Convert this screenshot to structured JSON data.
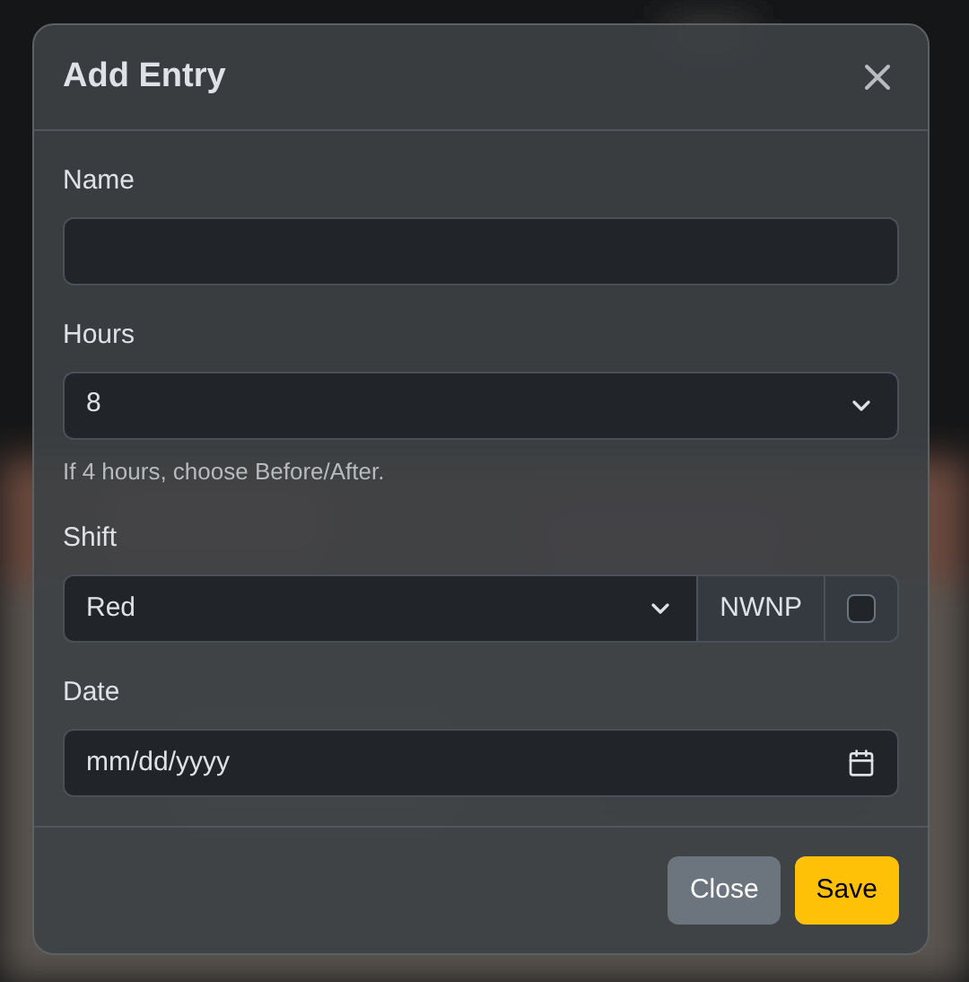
{
  "dialog": {
    "title": "Add Entry"
  },
  "fields": [
    {
      "kind": "text",
      "label": "Name"
    },
    {
      "kind": "select",
      "label": "Hours",
      "value": "8",
      "help": "If 4 hours, choose Before/After."
    },
    {
      "kind": "select-addon",
      "label": "Shift",
      "value": "Red",
      "addon": "NWNP",
      "checked": false
    },
    {
      "kind": "date",
      "label": "Date",
      "placeholder": "mm/dd/yyyy"
    }
  ],
  "buttons": [
    {
      "label": "Close",
      "kind": "secondary"
    },
    {
      "label": "Save",
      "kind": "primary"
    }
  ]
}
